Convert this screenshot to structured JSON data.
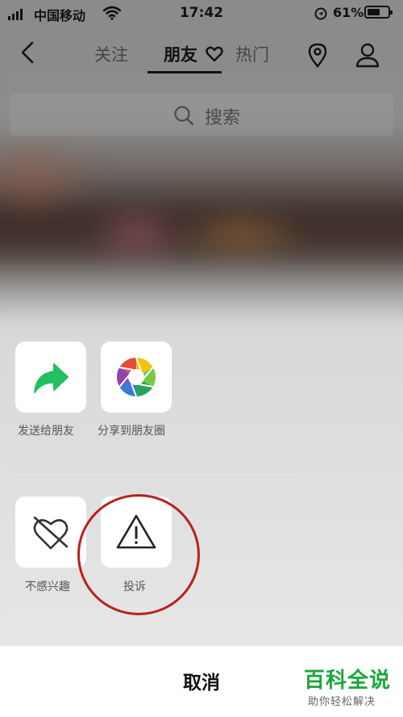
{
  "status_bar": {
    "carrier": "中国移动",
    "time": "17:42",
    "battery_percent": "61%",
    "battery_level": 0.61,
    "icons": [
      "signal-icon",
      "wifi-icon",
      "location-lock-icon",
      "battery-icon"
    ]
  },
  "nav": {
    "tabs": [
      {
        "label": "关注"
      },
      {
        "label": "朋友",
        "active": true
      },
      {
        "label": "热门"
      }
    ],
    "icons": [
      "back-icon",
      "heart-icon",
      "location-pin-icon",
      "user-icon"
    ]
  },
  "search": {
    "placeholder": "搜索"
  },
  "share_sheet": {
    "row1": [
      {
        "label": "发送给朋友",
        "icon": "share-arrow-icon"
      },
      {
        "label": "分享到朋友圈",
        "icon": "moments-aperture-icon"
      }
    ],
    "row2": [
      {
        "label": "不感兴趣",
        "icon": "broken-heart-icon"
      },
      {
        "label": "投诉",
        "icon": "warning-icon"
      }
    ],
    "cancel_label": "取消"
  },
  "watermark": {
    "title": "百科全说",
    "subtitle": "助你轻松解决"
  },
  "colors": {
    "accent_green": "#1aa73a",
    "annotation_red": "#b5221f",
    "share_green": "#22c05e"
  }
}
